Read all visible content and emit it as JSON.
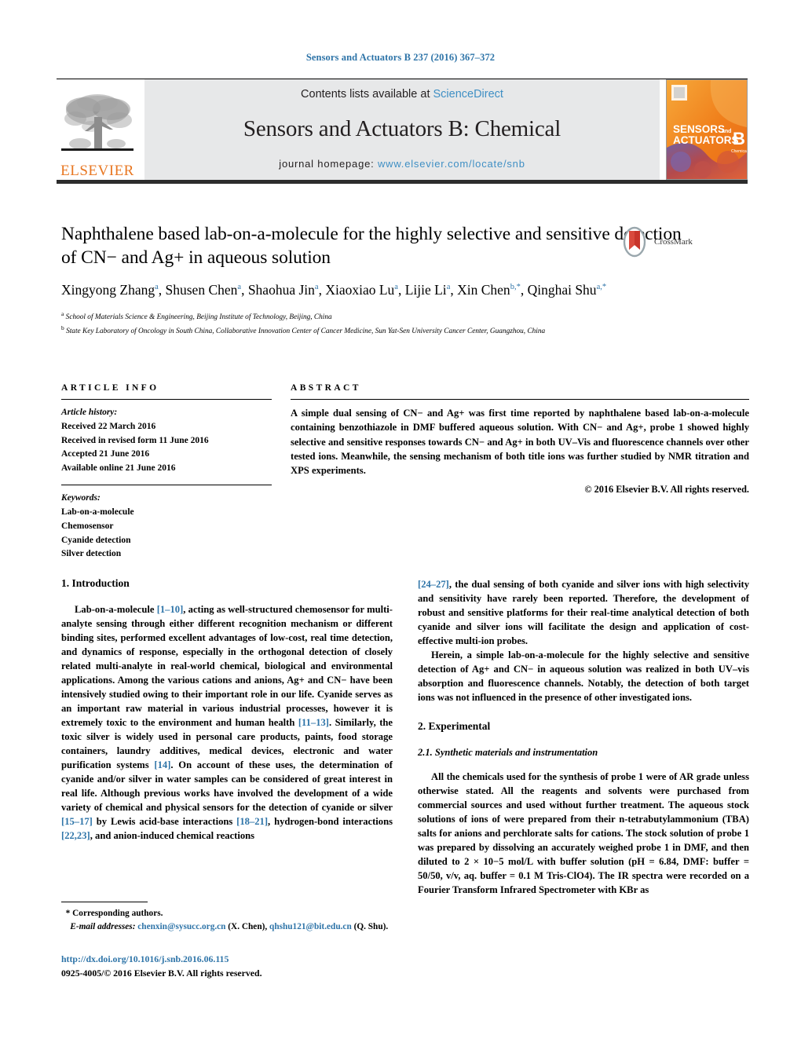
{
  "running_head": "Sensors and Actuators B 237 (2016) 367–372",
  "masthead": {
    "contents_prefix": "Contents lists available at ",
    "contents_link": "ScienceDirect",
    "journal_name": "Sensors and Actuators B: Chemical",
    "homepage_prefix": "journal homepage: ",
    "homepage_url": "www.elsevier.com/locate/snb",
    "publisher": "ELSEVIER",
    "cover_line1": "SENSORS",
    "cover_and": "and",
    "cover_line2": "ACTUATORS",
    "cover_letter": "B",
    "cover_sub": "Chemical"
  },
  "crossmark": {
    "label": "CrossMark"
  },
  "title": "Naphthalene based lab-on-a-molecule for the highly selective and sensitive detection of CN− and Ag+ in aqueous solution",
  "authors": [
    {
      "name": "Xingyong Zhang",
      "sup": "a"
    },
    {
      "name": "Shusen Chen",
      "sup": "a"
    },
    {
      "name": "Shaohua Jin",
      "sup": "a"
    },
    {
      "name": "Xiaoxiao Lu",
      "sup": "a"
    },
    {
      "name": "Lijie Li",
      "sup": "a"
    },
    {
      "name": "Xin Chen",
      "sup": "b,*"
    },
    {
      "name": "Qinghai Shu",
      "sup": "a,*"
    }
  ],
  "affiliations": [
    {
      "mark": "a",
      "text": "School of Materials Science & Engineering, Beijing Institute of Technology, Beijing, China"
    },
    {
      "mark": "b",
      "text": "State Key Laboratory of Oncology in South China, Collaborative Innovation Center of Cancer Medicine, Sun Yat-Sen University Cancer Center, Guangzhou, China"
    }
  ],
  "article_info": {
    "heading": "ARTICLE INFO",
    "history_label": "Article history:",
    "history": [
      "Received 22 March 2016",
      "Received in revised form 11 June 2016",
      "Accepted 21 June 2016",
      "Available online 21 June 2016"
    ],
    "keywords_label": "Keywords:",
    "keywords": [
      "Lab-on-a-molecule",
      "Chemosensor",
      "Cyanide detection",
      "Silver detection"
    ]
  },
  "abstract": {
    "heading": "ABSTRACT",
    "text": "A simple dual sensing of CN− and Ag+ was first time reported by naphthalene based lab-on-a-molecule containing benzothiazole in DMF buffered aqueous solution. With CN− and Ag+, probe 1 showed highly selective and sensitive responses towards CN− and Ag+ in both UV–Vis and fluorescence channels over other tested ions. Meanwhile, the sensing mechanism of both title ions was further studied by NMR titration and XPS experiments.",
    "copyright": "© 2016 Elsevier B.V. All rights reserved."
  },
  "sections": {
    "introduction_heading": "1. Introduction",
    "intro_p1_a": "Lab-on-a-molecule ",
    "intro_p1_ref1": "[1–10]",
    "intro_p1_b": ", acting as well-structured chemosensor for multi-analyte sensing through either different recognition mechanism or different binding sites, performed excellent advantages of low-cost, real time detection, and dynamics of response, especially in the orthogonal detection of closely related multi-analyte in real-world chemical, biological and environmental applications. Among the various cations and anions, Ag+ and CN− have been intensively studied owing to their important role in our life. Cyanide serves as an important raw material in various industrial processes, however it is extremely toxic to the environment and human health ",
    "intro_p1_ref2": "[11–13]",
    "intro_p1_c": ". Similarly, the toxic silver is widely used in personal care products, paints, food storage containers, laundry additives, medical devices, electronic and water purification systems ",
    "intro_p1_ref3": "[14]",
    "intro_p1_d": ". On account of these uses, the determination of cyanide and/or silver in water samples can be considered of great interest in real life. Although previous works have involved the development of a wide variety of chemical and physical sensors for the detection of cyanide or silver ",
    "intro_p1_ref4": "[15–17]",
    "intro_p1_e": " by Lewis acid-base interactions ",
    "intro_p1_ref5": "[18–21]",
    "intro_p1_f": ", hydrogen-bond interactions ",
    "intro_p1_ref6": "[22,23]",
    "intro_p1_g": ", and anion-induced chemical reactions ",
    "intro_p1_ref7": "[24–27]",
    "intro_p1_h": ", the dual sensing of both cyanide and silver ions with high selectivity and sensitivity have rarely been reported. Therefore, the development of robust and sensitive platforms for their real-time analytical detection of both cyanide and silver ions will facilitate the design and application of cost-effective multi-ion probes.",
    "intro_p2": "Herein, a simple lab-on-a-molecule for the highly selective and sensitive detection of Ag+ and CN− in aqueous solution was realized in both UV–vis absorption and fluorescence channels. Notably, the detection of both target ions was not influenced in the presence of other investigated ions.",
    "experimental_heading": "2. Experimental",
    "experimental_sub": "2.1. Synthetic materials and instrumentation",
    "experimental_p1": "All the chemicals used for the synthesis of probe 1 were of AR grade unless otherwise stated. All the reagents and solvents were purchased from commercial sources and used without further treatment. The aqueous stock solutions of ions of were prepared from their n-tetrabutylammonium (TBA) salts for anions and perchlorate salts for cations. The stock solution of probe 1 was prepared by dissolving an accurately weighed probe 1 in DMF, and then diluted to 2 × 10−5 mol/L with buffer solution (pH = 6.84, DMF: buffer = 50/50, v/v, aq. buffer = 0.1 M Tris-ClO4). The IR spectra were recorded on a Fourier Transform Infrared Spectrometer with KBr as"
  },
  "footnote": {
    "star": "*",
    "corresponding": "Corresponding authors.",
    "email_label": "E-mail addresses:",
    "email1": "chenxin@sysucc.org.cn",
    "email1_owner": "(X. Chen),",
    "email2": "qhshu121@bit.edu.cn",
    "email2_owner": "(Q. Shu)."
  },
  "doi": "http://dx.doi.org/10.1016/j.snb.2016.06.115",
  "issn_line": "0925-4005/© 2016 Elsevier B.V. All rights reserved.",
  "colors": {
    "link_blue": "#2e74a8",
    "sciencedirect_blue": "#3f8fc4",
    "elsevier_orange": "#E87722",
    "masthead_grey": "#e7e8e9"
  }
}
